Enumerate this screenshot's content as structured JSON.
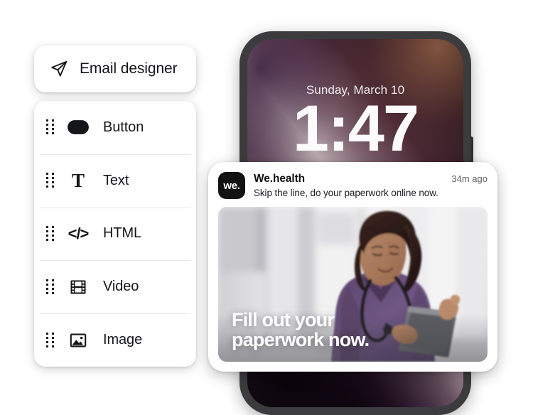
{
  "designer": {
    "title": "Email designer",
    "icon": "send-icon",
    "blocks": [
      {
        "label": "Button",
        "icon": "button-icon"
      },
      {
        "label": "Text",
        "icon": "text-icon"
      },
      {
        "label": "HTML",
        "icon": "html-code-icon"
      },
      {
        "label": "Video",
        "icon": "video-film-icon"
      },
      {
        "label": "Image",
        "icon": "image-photo-icon"
      }
    ]
  },
  "phone": {
    "lock_screen": {
      "date": "Sunday, March 10",
      "time": "1:47"
    },
    "notification": {
      "app_icon_text": "we.",
      "app_name": "We.health",
      "timestamp": "34m ago",
      "message": "Skip the line, do your paperwork online now.",
      "image": {
        "headline_line1": "Fill out your",
        "headline_line2": "paperwork now.",
        "description": "Smiling nurse in purple scrubs with a stethoscope holding a tablet in a bright clinic hallway"
      }
    }
  },
  "colors": {
    "card_background": "#ffffff",
    "text_primary": "#15161a",
    "text_secondary": "#5c5f66",
    "phone_frame": "#3c3c3e",
    "app_icon_background": "#121212",
    "scrubs_purple": "#6b5280",
    "divider": "#e6e6e6"
  }
}
